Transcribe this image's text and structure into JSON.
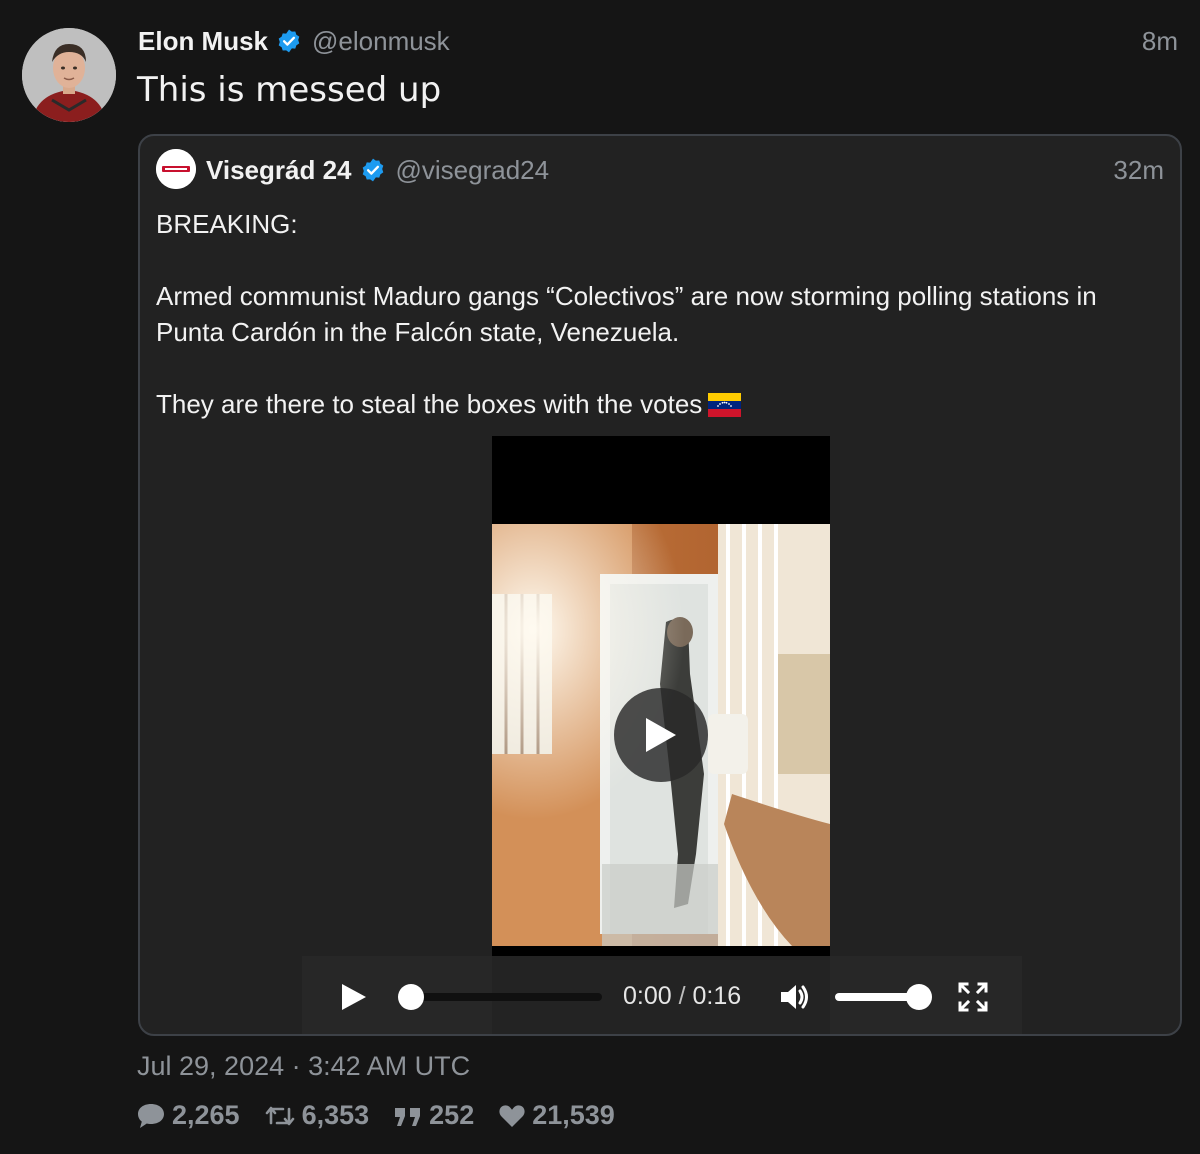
{
  "tweet": {
    "author_name": "Elon Musk",
    "author_handle": "@elonmusk",
    "time": "8m",
    "text": "This is messed up",
    "date": "Jul 29, 2024 · 3:42 AM UTC",
    "stats": {
      "replies": "2,265",
      "retweets": "6,353",
      "quotes": "252",
      "likes": "21,539"
    }
  },
  "quote": {
    "author_name": "Visegrád 24",
    "author_handle": "@visegrad24",
    "time": "32m",
    "paragraphs": [
      "BREAKING:",
      "Armed communist Maduro gangs “Colectivos” are now storming polling stations in Punta Cardón in the Falcón state, Venezuela.",
      "They are there to steal the boxes with the votes"
    ],
    "video": {
      "current_time": "0:00",
      "separator": "/",
      "duration": "0:16",
      "progress": 0.0,
      "volume": 1.0
    }
  },
  "colors": {
    "background": "#151515",
    "card": "#222222",
    "verified": "#1d9bf0",
    "muted_text": "#8e9399"
  }
}
